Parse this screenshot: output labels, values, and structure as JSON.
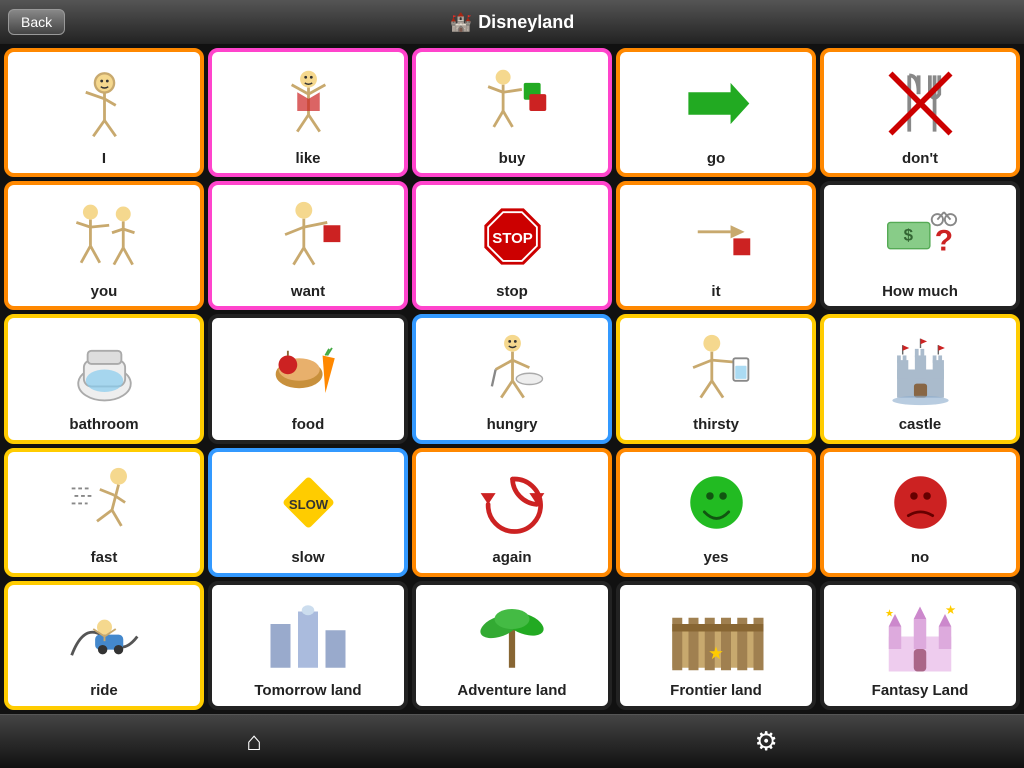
{
  "header": {
    "title": "Disneyland",
    "back_label": "Back"
  },
  "footer": {
    "home_icon": "⌂",
    "settings_icon": "⚙"
  },
  "cells": [
    {
      "id": "i",
      "label": "I",
      "border": "border-orange"
    },
    {
      "id": "like",
      "label": "like",
      "border": "border-pink"
    },
    {
      "id": "buy",
      "label": "buy",
      "border": "border-pink"
    },
    {
      "id": "go",
      "label": "go",
      "border": "border-orange"
    },
    {
      "id": "dont",
      "label": "don't",
      "border": "border-orange"
    },
    {
      "id": "you",
      "label": "you",
      "border": "border-orange"
    },
    {
      "id": "want",
      "label": "want",
      "border": "border-pink"
    },
    {
      "id": "stop",
      "label": "stop",
      "border": "border-pink"
    },
    {
      "id": "it",
      "label": "it",
      "border": "border-orange"
    },
    {
      "id": "howmuch",
      "label": "How much",
      "border": "border-black"
    },
    {
      "id": "bathroom",
      "label": "bathroom",
      "border": "border-yellow"
    },
    {
      "id": "food",
      "label": "food",
      "border": "border-black"
    },
    {
      "id": "hungry",
      "label": "hungry",
      "border": "border-blue"
    },
    {
      "id": "thirsty",
      "label": "thirsty",
      "border": "border-yellow"
    },
    {
      "id": "castle",
      "label": "castle",
      "border": "border-yellow"
    },
    {
      "id": "fast",
      "label": "fast",
      "border": "border-yellow"
    },
    {
      "id": "slow",
      "label": "slow",
      "border": "border-blue"
    },
    {
      "id": "again",
      "label": "again",
      "border": "border-orange"
    },
    {
      "id": "yes",
      "label": "yes",
      "border": "border-orange"
    },
    {
      "id": "no",
      "label": "no",
      "border": "border-orange"
    },
    {
      "id": "ride",
      "label": "ride",
      "border": "border-yellow"
    },
    {
      "id": "tomorrowland",
      "label": "Tomorrow land",
      "border": "border-black"
    },
    {
      "id": "adventureland",
      "label": "Adventure land",
      "border": "border-black"
    },
    {
      "id": "frontierland",
      "label": "Frontier land",
      "border": "border-black"
    },
    {
      "id": "fantasyland",
      "label": "Fantasy Land",
      "border": "border-black"
    }
  ]
}
